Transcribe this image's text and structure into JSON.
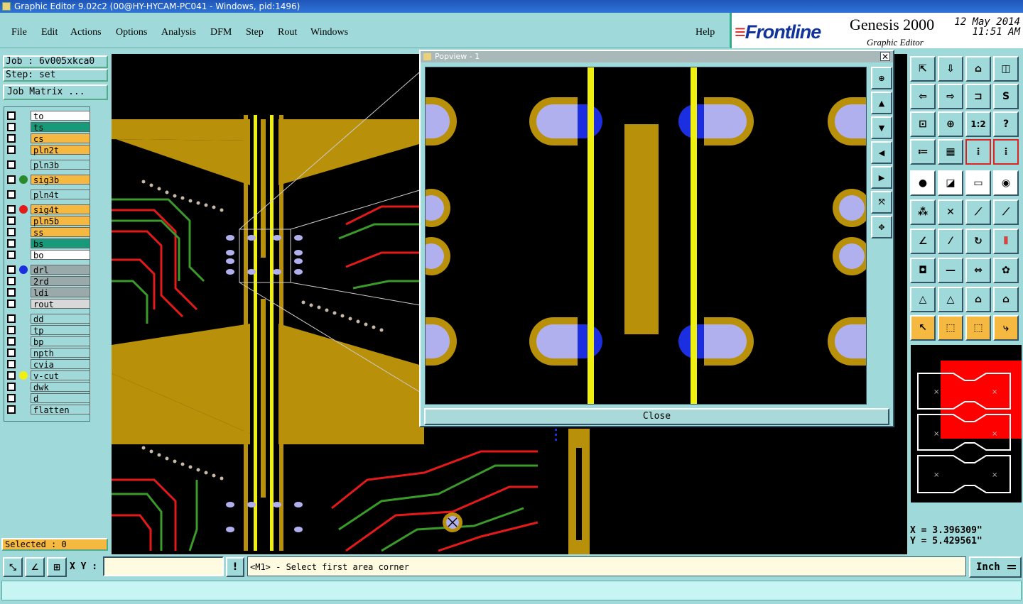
{
  "window": {
    "title": "Graphic Editor 9.02c2 (00@HY-HYCAM-PC041 - Windows, pid:1496)"
  },
  "menu": [
    {
      "label": "File",
      "name": "menu-file"
    },
    {
      "label": "Edit",
      "name": "menu-edit"
    },
    {
      "label": "Actions",
      "name": "menu-actions"
    },
    {
      "label": "Options",
      "name": "menu-options"
    },
    {
      "label": "Analysis",
      "name": "menu-analysis"
    },
    {
      "label": "DFM",
      "name": "menu-dfm"
    },
    {
      "label": "Step",
      "name": "menu-step"
    },
    {
      "label": "Rout",
      "name": "menu-rout"
    },
    {
      "label": "Windows",
      "name": "menu-windows"
    },
    {
      "label": "Help",
      "name": "menu-help"
    }
  ],
  "brand": {
    "logo": "Frontline",
    "product": "Genesis 2000",
    "subtitle": "Graphic Editor",
    "date": "12 May 2014",
    "time": "11:51 AM"
  },
  "job": {
    "job_label": "Job : 6v005xkca0",
    "step_label": "Step: set",
    "matrix_button": "Job Matrix ..."
  },
  "layers": [
    {
      "name": "to",
      "color": "#ffffff",
      "dot": ""
    },
    {
      "name": "ts",
      "color": "#169a7a",
      "dot": ""
    },
    {
      "name": "cs",
      "color": "#f5b840",
      "dot": ""
    },
    {
      "name": "pln2t",
      "color": "#f5b840",
      "dot": ""
    },
    {
      "name": "pln3b",
      "color": "#9fd9d9",
      "dot": ""
    },
    {
      "name": "sig3b",
      "color": "#f5b840",
      "dot": "#2a8a2a"
    },
    {
      "name": "pln4t",
      "color": "#9fd9d9",
      "dot": ""
    },
    {
      "name": "sig4t",
      "color": "#f5b840",
      "dot": "#e41a1a"
    },
    {
      "name": "pln5b",
      "color": "#f5b840",
      "dot": ""
    },
    {
      "name": "ss",
      "color": "#f5b840",
      "dot": ""
    },
    {
      "name": "bs",
      "color": "#169a7a",
      "dot": ""
    },
    {
      "name": "bo",
      "color": "#ffffff",
      "dot": ""
    },
    {
      "name": "drl",
      "color": "#9aa9a9",
      "dot": "#1b2fe0"
    },
    {
      "name": "2rd",
      "color": "#9aa9a9",
      "dot": ""
    },
    {
      "name": "ldi",
      "color": "#9aa9a9",
      "dot": ""
    },
    {
      "name": "rout",
      "color": "#d8d8d8",
      "dot": ""
    },
    {
      "name": "dd",
      "color": "#9fd9d9",
      "dot": ""
    },
    {
      "name": "tp",
      "color": "#9fd9d9",
      "dot": ""
    },
    {
      "name": "bp",
      "color": "#9fd9d9",
      "dot": ""
    },
    {
      "name": "npth",
      "color": "#9fd9d9",
      "dot": ""
    },
    {
      "name": "cvia",
      "color": "#9fd9d9",
      "dot": ""
    },
    {
      "name": "v-cut",
      "color": "#9fd9d9",
      "dot": "#f0f010"
    },
    {
      "name": "dwk",
      "color": "#9fd9d9",
      "dot": ""
    },
    {
      "name": "d",
      "color": "#9fd9d9",
      "dot": ""
    },
    {
      "name": "flatten",
      "color": "#9fd9d9",
      "dot": ""
    }
  ],
  "selected_label": "Selected : 0",
  "popview": {
    "title": "Popview - 1",
    "close_label": "Close"
  },
  "coords": {
    "x": "X = 3.396309\"",
    "y": "Y = 5.429561\""
  },
  "status": {
    "xy_label": "X Y :",
    "xy_value": "",
    "message": "<M1> - Select first area corner",
    "unit": "Inch"
  },
  "colors": {
    "panel": "#9fd9d9",
    "copper": "#b8900a",
    "trace_red": "#e41a1a",
    "trace_green": "#3a9a2a",
    "pad": "#b0b0ee",
    "vcut": "#f0f010"
  }
}
